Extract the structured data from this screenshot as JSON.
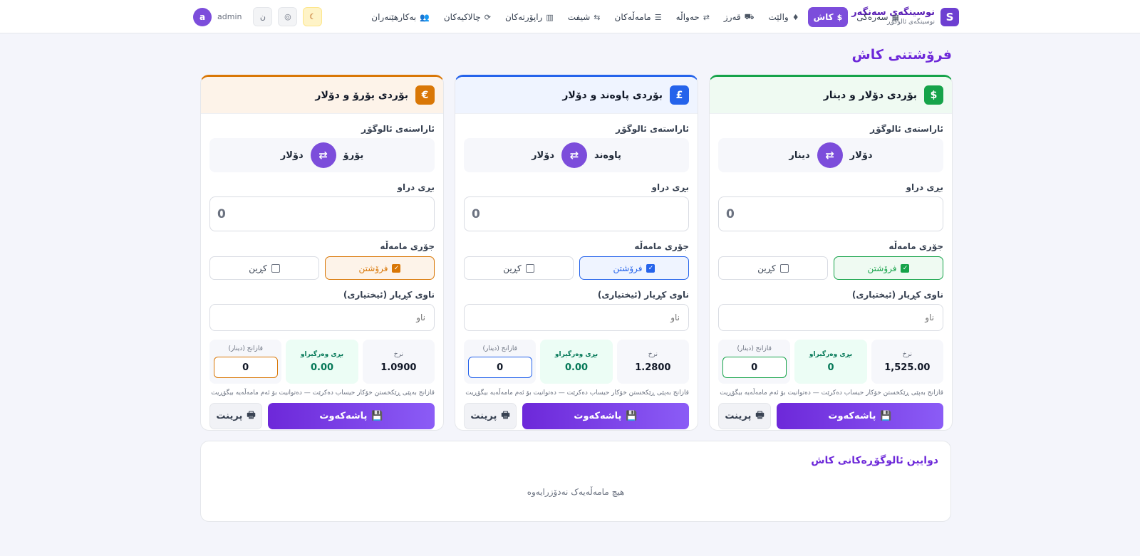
{
  "brand": {
    "logo": "S",
    "title": "نوسینگەی سەنگەر",
    "subtitle": "نوسینگەی ئالوگۆڕ"
  },
  "nav": [
    {
      "label": "سەرەکی",
      "icon": "▦",
      "name": "dashboard-icon"
    },
    {
      "label": "کاش",
      "icon": "$",
      "name": "dollar-icon",
      "active": true
    },
    {
      "label": "والێت",
      "icon": "♦",
      "name": "wallet-icon"
    },
    {
      "label": "قەرز",
      "icon": "⛟",
      "name": "debt-icon"
    },
    {
      "label": "حەواڵە",
      "icon": "⇄",
      "name": "transfer-icon"
    },
    {
      "label": "مامەڵەکان",
      "icon": "☰",
      "name": "list-icon"
    },
    {
      "label": "شیفت",
      "icon": "⇆",
      "name": "shift-icon"
    },
    {
      "label": "راپۆرتەکان",
      "icon": "▥",
      "name": "report-icon"
    },
    {
      "label": "چالاکیەکان",
      "icon": "⟳",
      "name": "activity-icon"
    },
    {
      "label": "بەکارهێنەران",
      "icon": "👥",
      "name": "users-icon"
    }
  ],
  "user": {
    "initial": "a",
    "name": "admin"
  },
  "icons": {
    "lang": "ن",
    "theme": "◎",
    "moon": "☾",
    "swap": "⇄",
    "save": "💾",
    "print": "🖶",
    "check": "✓"
  },
  "page_title": "فرۆشتنی کاش",
  "labels": {
    "direction": "ئاراستەی ئالوگۆڕ",
    "amount": "بڕی دراو",
    "type": "جۆری مامەڵە",
    "sell": "فرۆشتن",
    "buy": "کڕین",
    "customer": "ناوی کڕیار (ئیختیاری)",
    "customer_placeholder": "ناو",
    "rate": "نرخ",
    "received": "بڕی وەرگیراو",
    "profit": "قازانج (دینار)",
    "hint": "قازانج بەپێی ڕێکخستن خۆکار حیساب دەکرێت — دەتوانیت بۆ ئەم مامەڵەیە بیگۆڕیت",
    "save": "پاشەکەوت",
    "print": "پرینت"
  },
  "cards": [
    {
      "title": "بۆردی دۆلار و دینار",
      "symbol": "$",
      "from": "دۆلار",
      "to": "دینار",
      "amount": "0",
      "rate": "1,525.00",
      "received": "0",
      "profit": "0",
      "accent": "#16a34a",
      "tint": "#effaf2"
    },
    {
      "title": "بۆردی پاوەند و دۆلار",
      "symbol": "£",
      "from": "پاوەند",
      "to": "دۆلار",
      "amount": "0",
      "rate": "1.2800",
      "received": "0.00",
      "profit": "0",
      "accent": "#2563eb",
      "tint": "#eff4ff"
    },
    {
      "title": "بۆردی یۆرۆ و دۆلار",
      "symbol": "€",
      "from": "یۆرۆ",
      "to": "دۆلار",
      "amount": "0",
      "rate": "1.0900",
      "received": "0.00",
      "profit": "0",
      "accent": "#d97706",
      "tint": "#fdf3e9"
    }
  ],
  "recent": {
    "title": "دوایین ئالوگۆڕەکانی کاش",
    "empty": "هیچ مامەڵەیەک نەدۆزرایەوە"
  }
}
